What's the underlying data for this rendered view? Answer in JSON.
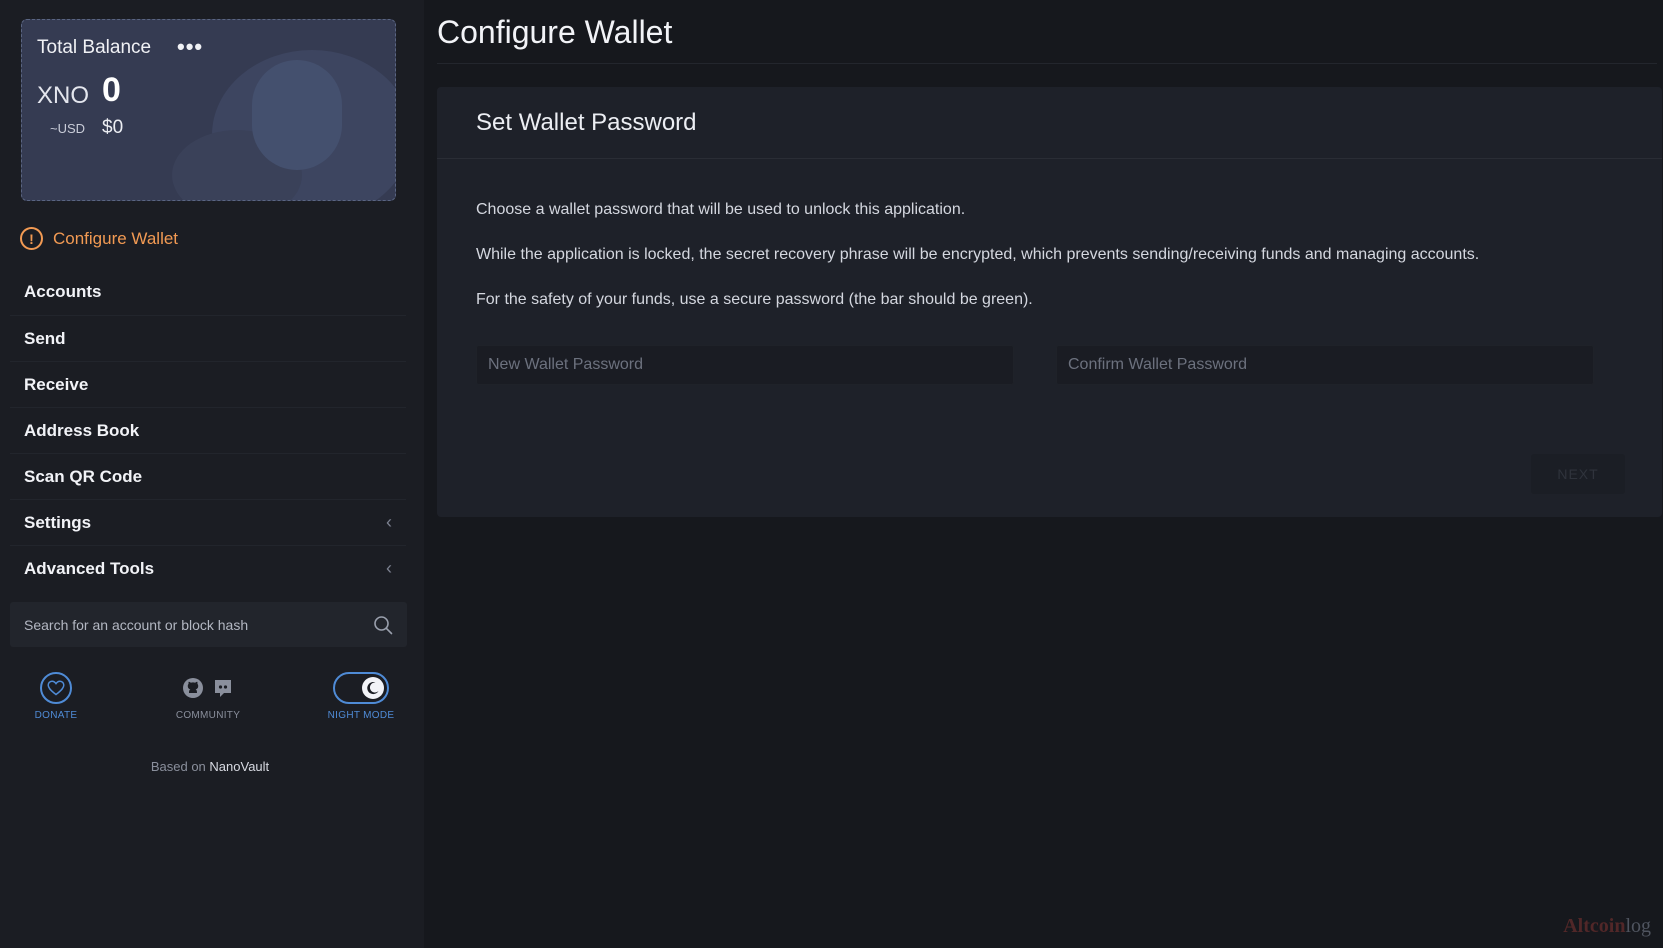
{
  "balance": {
    "title": "Total Balance",
    "more": "•••",
    "currency": "XNO",
    "amount": "0",
    "usd_label": "~USD",
    "usd_value": "$0"
  },
  "sidebar": {
    "configure_label": "Configure Wallet",
    "configure_alert": "!",
    "items": [
      {
        "label": "Accounts"
      },
      {
        "label": "Send"
      },
      {
        "label": "Receive"
      },
      {
        "label": "Address Book"
      },
      {
        "label": "Scan QR Code"
      },
      {
        "label": "Settings",
        "chevron": "‹"
      },
      {
        "label": "Advanced Tools",
        "chevron": "‹"
      }
    ],
    "search_placeholder": "Search for an account or block hash",
    "footer": {
      "donate": "DONATE",
      "community": "COMMUNITY",
      "night_mode": "NIGHT MODE"
    },
    "based_on_prefix": "Based on",
    "based_on_link": "NanoVault"
  },
  "main": {
    "title": "Configure Wallet",
    "card": {
      "header": "Set Wallet Password",
      "paragraphs": [
        "Choose a wallet password that will be used to unlock this application.",
        "While the application is locked, the secret recovery phrase will be encrypted, which prevents sending/receiving funds and managing accounts.",
        "For the safety of your funds, use a secure password (the bar should be green)."
      ],
      "new_password_placeholder": "New Wallet Password",
      "confirm_password_placeholder": "Confirm Wallet Password",
      "next_label": "NEXT"
    }
  },
  "watermark": {
    "brand": "Altcoin",
    "tail": "log"
  },
  "colors": {
    "accent_blue": "#4f8bd6",
    "warning_orange": "#f29a53",
    "sidebar_bg": "#1b1d23",
    "card_bg": "#1e2129"
  },
  "icons": {
    "more": "more-dots-icon",
    "alert": "alert-circle-icon",
    "search": "search-icon",
    "donate": "heart-icon",
    "github": "github-icon",
    "discord": "discord-icon",
    "night": "moon-icon"
  }
}
